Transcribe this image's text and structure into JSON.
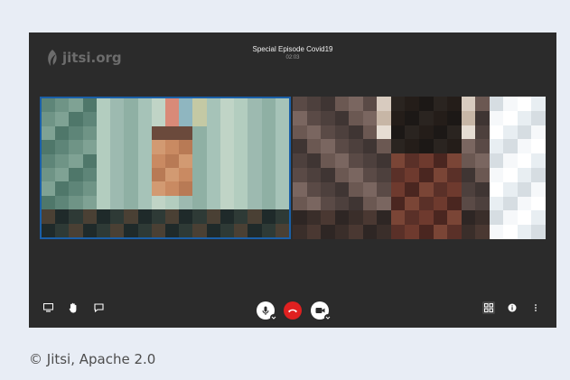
{
  "branding": {
    "logo_text": "jitsi.org",
    "logo_icon": "jitsi-leaf-icon"
  },
  "meeting": {
    "title": "Special Episode Covid19",
    "timer": "02:03"
  },
  "participants": [
    {
      "id": "local",
      "view": "camera-feed-pixelated",
      "active_speaker": true
    },
    {
      "id": "remote",
      "view": "camera-feed-pixelated",
      "active_speaker": false
    }
  ],
  "toolbar": {
    "left": [
      "screen-share-icon",
      "raise-hand-icon",
      "chat-icon"
    ],
    "center": [
      "microphone-icon",
      "hangup-icon",
      "camera-icon"
    ],
    "right": [
      "tile-view-icon",
      "info-icon",
      "more-options-icon"
    ]
  },
  "colors": {
    "background": "#e8edf5",
    "meeting_bg": "#2b2b2b",
    "active_border": "#1a5fa8",
    "hangup": "#e02020"
  },
  "caption": "© Jitsi, Apache 2.0"
}
